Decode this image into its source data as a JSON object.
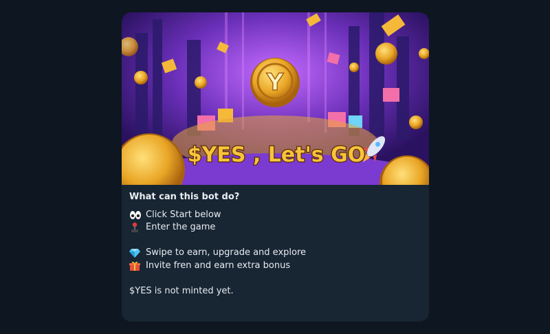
{
  "bot_card": {
    "banner": {
      "headline": "$YES , Let's GO",
      "coin_letter": "Y"
    },
    "title": "What can this bot do?",
    "lines": [
      {
        "icon": "eyes-icon",
        "text": "Click Start below"
      },
      {
        "icon": "joystick-icon",
        "text": "Enter the game"
      },
      {
        "icon": "gem-icon",
        "text": "Swipe to earn, upgrade and explore"
      },
      {
        "icon": "gift-icon",
        "text": "Invite fren and earn extra bonus"
      }
    ],
    "footer": "$YES is not minted yet."
  },
  "colors": {
    "page_bg": "#0e1621",
    "card_bg": "#182533",
    "text": "#e8edf2",
    "coin_gold": "#e9a626",
    "headline_gold": "#f6c33a"
  }
}
